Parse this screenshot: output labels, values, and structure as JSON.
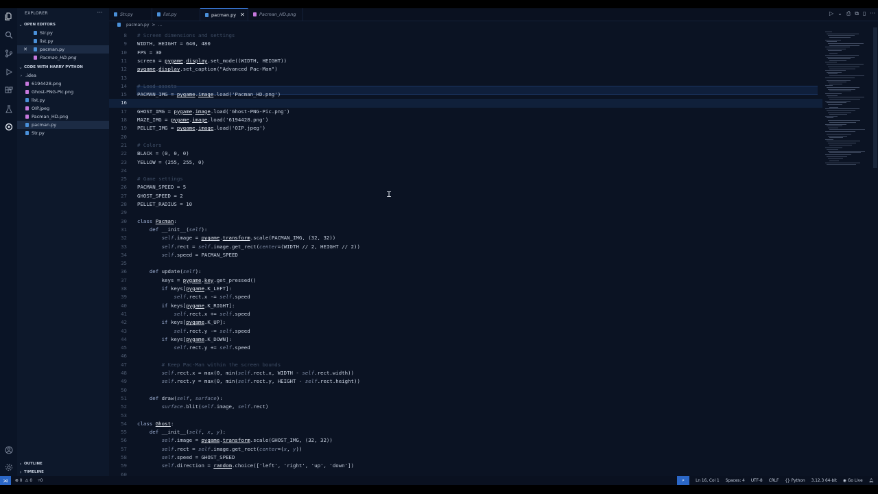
{
  "sidebar": {
    "title": "EXPLORER",
    "more": "···",
    "open_editors_label": "OPEN EDITORS",
    "open_editors": [
      {
        "name": "Str.py",
        "color": "#4a90d9"
      },
      {
        "name": "list.py",
        "color": "#4a90d9"
      },
      {
        "name": "pacman.py",
        "color": "#4a90d9",
        "close": "✕"
      },
      {
        "name": "Pacman_HD.png",
        "color": "#c678dd"
      }
    ],
    "folder_label": "CODE WITH HARRY PYTHON",
    "files": [
      {
        "name": ".idea",
        "color": "#9aa4b6",
        "chev": "›"
      },
      {
        "name": "6194428.png",
        "color": "#c678dd"
      },
      {
        "name": "Ghost-PNG-Pic.png",
        "color": "#c678dd"
      },
      {
        "name": "list.py",
        "color": "#4a90d9"
      },
      {
        "name": "OIP.jpeg",
        "color": "#c678dd"
      },
      {
        "name": "Pacman_HD.png",
        "color": "#c678dd"
      },
      {
        "name": "pacman.py",
        "color": "#4a90d9"
      },
      {
        "name": "Str.py",
        "color": "#4a90d9"
      }
    ],
    "outline_label": "OUTLINE",
    "timeline_label": "TIMELINE"
  },
  "tabs": [
    {
      "label": "Str.py"
    },
    {
      "label": "list.py"
    },
    {
      "label": "pacman.py",
      "close": "✕"
    },
    {
      "label": "Pacman_HD.png"
    }
  ],
  "breadcrumb": {
    "file": "pacman.py",
    "sep": ">",
    "rest": "..."
  },
  "code_lines": [
    {
      "n": "8",
      "html": "<span class='cm'># Screen dimensions and settings</span>"
    },
    {
      "n": "9",
      "html": "WIDTH, HEIGHT = 640, 480"
    },
    {
      "n": "10",
      "html": "FPS = 30"
    },
    {
      "n": "11",
      "html": "screen = <span class='mod'>pygame</span>.<span class='mod'>display</span>.set_mode((WIDTH, HEIGHT))"
    },
    {
      "n": "12",
      "html": "<span class='mod'>pygame</span>.<span class='mod'>display</span>.set_caption(\"Advanced Pac-Man\")"
    },
    {
      "n": "13",
      "html": ""
    },
    {
      "n": "14",
      "html": "<span class='cm'># Load assets</span>"
    },
    {
      "n": "15",
      "html": "PACMAN_IMG = <span class='mod'>pygame</span>.<span class='mod'>image</span>.load('Pacman_HD.png')"
    },
    {
      "n": "16",
      "html": "",
      "current": true
    },
    {
      "n": "17",
      "html": "GHOST_IMG = <span class='mod'>pygame</span>.<span class='mod'>image</span>.load('Ghost-PNG-Pic.png')"
    },
    {
      "n": "18",
      "html": "MAZE_IMG = <span class='mod'>pygame</span>.<span class='mod'>image</span>.load('6194428.png')"
    },
    {
      "n": "19",
      "html": "PELLET_IMG = <span class='mod'>pygame</span>.<span class='mod'>image</span>.load('OIP.jpeg')"
    },
    {
      "n": "20",
      "html": ""
    },
    {
      "n": "21",
      "html": "<span class='cm'># Colors</span>"
    },
    {
      "n": "22",
      "html": "BLACK = (0, 0, 0)"
    },
    {
      "n": "23",
      "html": "YELLOW = (255, 255, 0)"
    },
    {
      "n": "24",
      "html": ""
    },
    {
      "n": "25",
      "html": "<span class='cm'># Game settings</span>"
    },
    {
      "n": "26",
      "html": "PACMAN_SPEED = 5"
    },
    {
      "n": "27",
      "html": "GHOST_SPEED = 2"
    },
    {
      "n": "28",
      "html": "PELLET_RADIUS = 10"
    },
    {
      "n": "29",
      "html": ""
    },
    {
      "n": "30",
      "html": "<span class='kw'>class</span> <span class='mod'>Pacman</span>:"
    },
    {
      "n": "31",
      "html": "    <span class='kw'>def</span> __init__(<span class='self'>self</span>):"
    },
    {
      "n": "32",
      "html": "        <span class='self'>self</span>.image = <span class='mod'>pygame</span>.<span class='mod'>transform</span>.scale(PACMAN_IMG, (32, 32))"
    },
    {
      "n": "33",
      "html": "        <span class='self'>self</span>.rect = <span class='self'>self</span>.image.get_rect(<span class='self'>center</span>=(WIDTH // 2, HEIGHT // 2))"
    },
    {
      "n": "34",
      "html": "        <span class='self'>self</span>.speed = PACMAN_SPEED"
    },
    {
      "n": "35",
      "html": ""
    },
    {
      "n": "36",
      "html": "    <span class='kw'>def</span> update(<span class='self'>self</span>):"
    },
    {
      "n": "37",
      "html": "        keys = <span class='mod'>pygame</span>.<span class='mod'>key</span>.get_pressed()"
    },
    {
      "n": "38",
      "html": "        <span class='kw'>if</span> keys[<span class='mod'>pygame</span>.K_LEFT]:"
    },
    {
      "n": "39",
      "html": "            <span class='self'>self</span>.rect.x -= <span class='self'>self</span>.speed"
    },
    {
      "n": "40",
      "html": "        <span class='kw'>if</span> keys[<span class='mod'>pygame</span>.K_RIGHT]:"
    },
    {
      "n": "41",
      "html": "            <span class='self'>self</span>.rect.x += <span class='self'>self</span>.speed"
    },
    {
      "n": "42",
      "html": "        <span class='kw'>if</span> keys[<span class='mod'>pygame</span>.K_UP]:"
    },
    {
      "n": "43",
      "html": "            <span class='self'>self</span>.rect.y -= <span class='self'>self</span>.speed"
    },
    {
      "n": "44",
      "html": "        <span class='kw'>if</span> keys[<span class='mod'>pygame</span>.K_DOWN]:"
    },
    {
      "n": "45",
      "html": "            <span class='self'>self</span>.rect.y += <span class='self'>self</span>.speed"
    },
    {
      "n": "46",
      "html": ""
    },
    {
      "n": "47",
      "html": "        <span class='cm'># Keep Pac-Man within the screen bounds</span>"
    },
    {
      "n": "48",
      "html": "        <span class='self'>self</span>.rect.x = max(0, min(<span class='self'>self</span>.rect.x, WIDTH - <span class='self'>self</span>.rect.width))"
    },
    {
      "n": "49",
      "html": "        <span class='self'>self</span>.rect.y = max(0, min(<span class='self'>self</span>.rect.y, HEIGHT - <span class='self'>self</span>.rect.height))"
    },
    {
      "n": "50",
      "html": ""
    },
    {
      "n": "51",
      "html": "    <span class='kw'>def</span> draw(<span class='self'>self</span>, <span class='self'>surface</span>):"
    },
    {
      "n": "52",
      "html": "        <span class='self'>surface</span>.blit(<span class='self'>self</span>.image, <span class='self'>self</span>.rect)"
    },
    {
      "n": "53",
      "html": ""
    },
    {
      "n": "54",
      "html": "<span class='kw'>class</span> <span class='mod'>Ghost</span>:"
    },
    {
      "n": "55",
      "html": "    <span class='kw'>def</span> __init__(<span class='self'>self</span>, <span class='self'>x</span>, <span class='self'>y</span>):"
    },
    {
      "n": "56",
      "html": "        <span class='self'>self</span>.image = <span class='mod'>pygame</span>.<span class='mod'>transform</span>.scale(GHOST_IMG, (32, 32))"
    },
    {
      "n": "57",
      "html": "        <span class='self'>self</span>.rect = <span class='self'>self</span>.image.get_rect(<span class='self'>center</span>=(<span class='self'>x</span>, <span class='self'>y</span>))"
    },
    {
      "n": "58",
      "html": "        <span class='self'>self</span>.speed = GHOST_SPEED"
    },
    {
      "n": "59",
      "html": "        <span class='self'>self</span>.direction = <span class='mod'>random</span>.choice(['left', 'right', 'up', 'down'])"
    },
    {
      "n": "60",
      "html": ""
    }
  ],
  "status": {
    "errors": "⊗ 0",
    "warnings": "⚠ 0",
    "ports": "⑂0",
    "position": "Ln 16, Col 1",
    "spaces": "Spaces: 4",
    "encoding": "UTF-8",
    "eol": "CRLF",
    "language": "Python",
    "interpreter": "3.12.3 64-bit",
    "golive": "Go Live"
  },
  "colors": {
    "accent": "#2b67c6",
    "editor_bg": "#0b1323",
    "sidebar_bg": "#0d182b"
  }
}
